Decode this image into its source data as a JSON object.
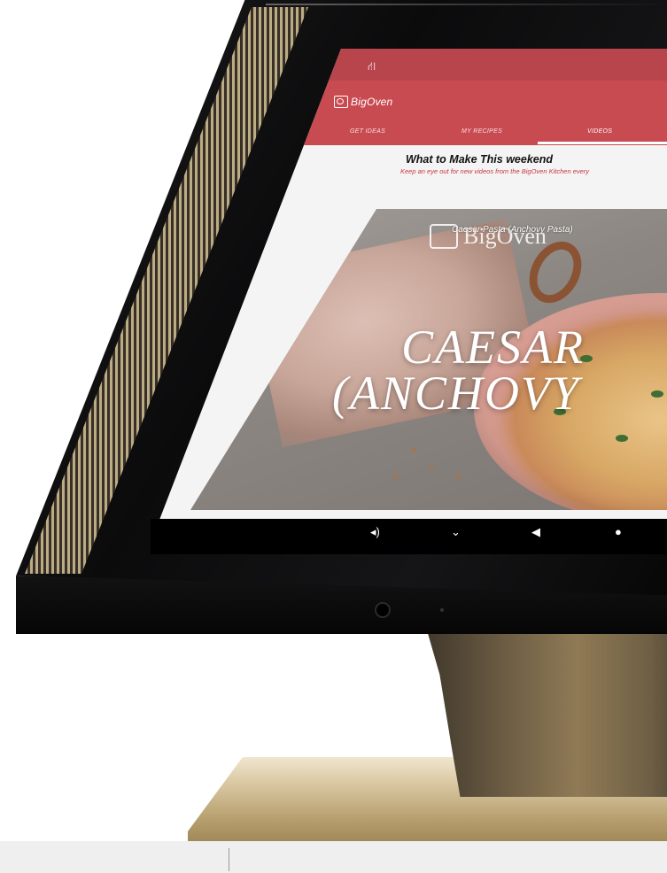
{
  "status_bar": {
    "icon": "network-icon"
  },
  "app": {
    "brand": "BigOven"
  },
  "tabs": [
    {
      "label": "GET IDEAS"
    },
    {
      "label": "MY RECIPES"
    },
    {
      "label": "VIDEOS",
      "active": true
    }
  ],
  "section": {
    "title": "What to Make This weekend",
    "subtitle": "Keep an eye out for new videos from the BigOven Kitchen every"
  },
  "video": {
    "label": "Caesar Pasta (Anchovy Pasta)",
    "watermark": "BigOven",
    "overlay_line1": "CAESAR",
    "overlay_line2": "(ANCHOVY",
    "play_icon": "play-icon"
  },
  "nav_bar": {
    "items": [
      {
        "icon": "volume-icon",
        "glyph": "◂)"
      },
      {
        "icon": "chevron-down-icon",
        "glyph": "⌄"
      },
      {
        "icon": "back-icon",
        "glyph": "◀"
      },
      {
        "icon": "home-icon",
        "glyph": "●"
      }
    ]
  },
  "colors": {
    "status_bar": "#b7454b",
    "app_bar": "#c94b52",
    "accent_text": "#c9353f",
    "screen_bg": "#f4f4f4"
  }
}
